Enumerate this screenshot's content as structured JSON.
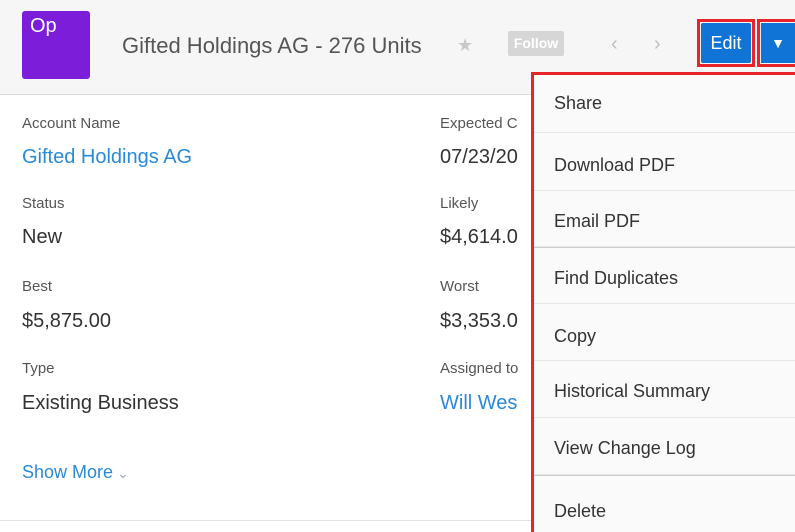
{
  "header": {
    "module_abbrev": "Op",
    "title": "Gifted Holdings AG - 276 Units",
    "star": "★",
    "follow_label": "Follow",
    "prev": "‹",
    "next": "›",
    "edit_label": "Edit",
    "caret": "▼"
  },
  "fields": {
    "account_name": {
      "label": "Account Name",
      "value": "Gifted Holdings AG"
    },
    "expected_close": {
      "label": "Expected C",
      "value": "07/23/20"
    },
    "status": {
      "label": "Status",
      "value": "New"
    },
    "likely": {
      "label": "Likely",
      "value": "$4,614.0"
    },
    "best": {
      "label": "Best",
      "value": "$5,875.00"
    },
    "worst": {
      "label": "Worst",
      "value": "$3,353.0"
    },
    "type": {
      "label": "Type",
      "value": "Existing Business"
    },
    "assigned_to": {
      "label": "Assigned to",
      "value": "Will Wes"
    }
  },
  "show_more": {
    "label": "Show More",
    "chevron": "⌄"
  },
  "menu": {
    "items": [
      "Share",
      "Download PDF",
      "Email PDF",
      "Find Duplicates",
      "Copy",
      "Historical Summary",
      "View Change Log",
      "Delete"
    ]
  },
  "colors": {
    "module_badge": "#7b1dd9",
    "primary_button": "#0f74d6",
    "highlight_outline": "#e8242a",
    "link": "#2a8ad6"
  }
}
